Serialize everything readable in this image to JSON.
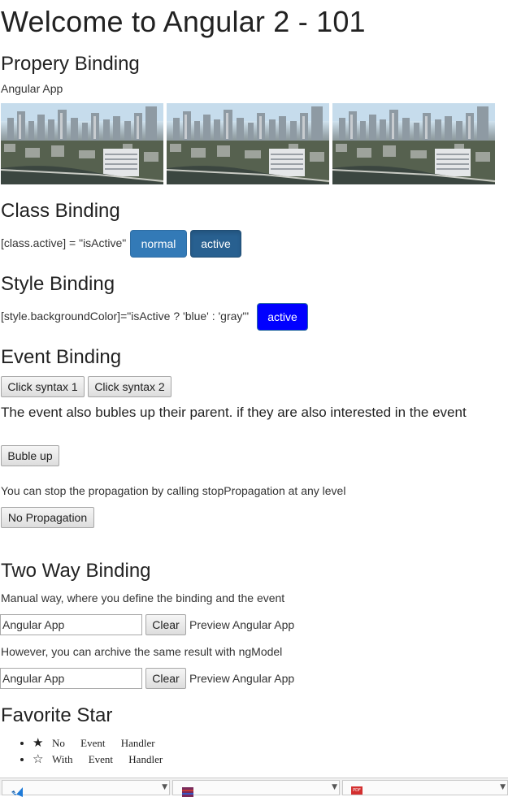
{
  "page": {
    "title": "Welcome to Angular 2 - 101"
  },
  "property_binding": {
    "heading": "Propery Binding",
    "text": "Angular App",
    "images": [
      "city-photo",
      "city-photo",
      "city-photo"
    ]
  },
  "class_binding": {
    "heading": "Class Binding",
    "expression": "[class.active] = \"isActive\"",
    "normal_label": "normal",
    "active_label": "active"
  },
  "style_binding": {
    "heading": "Style Binding",
    "expression": "[style.backgroundColor]=\"isActive ? 'blue' : 'gray'\"",
    "button_label": "active",
    "button_color": "#0000ff"
  },
  "event_binding": {
    "heading": "Event Binding",
    "click1": "Click syntax 1",
    "click2": "Click syntax 2",
    "bubble_text": "The event also bubles up their parent. if they are also interested in the event",
    "bubble_button": "Buble up",
    "stop_text": "You can stop the propagation by calling stopPropagation at any level",
    "stop_button": "No Propagation"
  },
  "two_way_binding": {
    "heading": "Two Way Binding",
    "manual_text": "Manual way, where you define the binding and the event",
    "manual_value": "Angular App",
    "clear_label": "Clear",
    "preview_text": "Preview Angular App",
    "ngmodel_text": "However, you can archive the same result with ngModel",
    "ngmodel_value": "Angular App"
  },
  "favorite_star": {
    "heading": "Favorite Star",
    "items": [
      {
        "glyph": "★",
        "icon": "star-filled-icon",
        "label": "No Event Handler"
      },
      {
        "glyph": "☆",
        "icon": "star-outline-icon",
        "label": "With Event Handler"
      }
    ]
  },
  "taskbar": {
    "items": [
      {
        "icon": "vscode-icon"
      },
      {
        "icon": "winrar-icon"
      },
      {
        "icon": "pdf-icon",
        "badge": "PDF"
      }
    ]
  }
}
